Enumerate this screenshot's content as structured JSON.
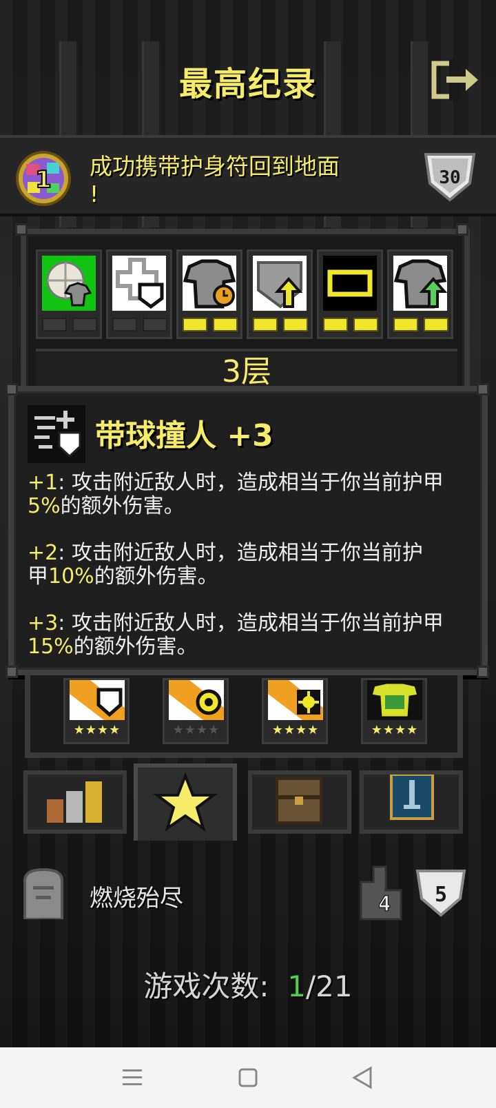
{
  "header": {
    "title": "最高纪录",
    "exit_icon": "exit-icon"
  },
  "badge": {
    "gem_icon": "rainbow-gem-icon",
    "gem_number": "1",
    "text_line1": "成功携带护身符回到地面",
    "text_line2": "!",
    "score": "30"
  },
  "equipment": {
    "slots": [
      {
        "icon": "scroll-armor-icon",
        "pips_on": 0,
        "pips_total": 2,
        "bg": "#11c411"
      },
      {
        "icon": "cross-armor-icon",
        "pips_on": 0,
        "pips_total": 2,
        "bg": "#ffffff"
      },
      {
        "icon": "armor-clock-icon",
        "pips_on": 2,
        "pips_total": 2,
        "bg": "#ffffff"
      },
      {
        "icon": "shield-up-icon",
        "pips_on": 2,
        "pips_total": 2,
        "bg": "#ffffff"
      },
      {
        "icon": "battery-icon",
        "pips_on": 2,
        "pips_total": 2,
        "bg": "#000000"
      },
      {
        "icon": "armor-up-icon",
        "pips_on": 2,
        "pips_total": 2,
        "bg": "#ffffff"
      }
    ],
    "floor_label": "3层"
  },
  "talent": {
    "icon": "shield-charge-icon",
    "title": "带球撞人 +3",
    "levels": [
      {
        "tag": "+1",
        "colon": ":",
        "line1": "攻击附近敌人时，造成相当于你当前护甲",
        "pct": "5%",
        "line2": "的额外伤害。",
        "lead": ""
      },
      {
        "tag": "+2",
        "colon": ":",
        "line1": "攻击附近敌人时，造成相当于你当前护",
        "lead": "甲",
        "pct": "10%",
        "line2": "的额外伤害。"
      },
      {
        "tag": "+3",
        "colon": ":",
        "line1": "攻击附近敌人时，造成相当于你当前护甲",
        "pct": "15%",
        "line2": "的额外伤害。",
        "lead": ""
      }
    ]
  },
  "lower_slots": [
    {
      "icon": "scroll-shield-icon",
      "stars": "★★★★",
      "active": true
    },
    {
      "icon": "scroll-coin-icon",
      "stars": "★★★★",
      "active": false
    },
    {
      "icon": "scroll-sun-icon",
      "stars": "★★★★",
      "active": true
    },
    {
      "icon": "armor-green-icon",
      "stars": "★★★★",
      "active": true
    }
  ],
  "tabs": [
    {
      "icon": "bar-chart-icon"
    },
    {
      "icon": "star-icon",
      "active": true
    },
    {
      "icon": "chest-icon"
    },
    {
      "icon": "sword-banner-icon"
    }
  ],
  "death": {
    "grave_icon": "gravestone-icon",
    "cause": "燃烧殆尽",
    "depth": "4",
    "level": "5"
  },
  "games": {
    "label": "游戏次数:",
    "current": "1",
    "total": "/21"
  },
  "colors": {
    "accent_yellow": "#f6ec6a",
    "accent_green": "#4ed04e"
  }
}
